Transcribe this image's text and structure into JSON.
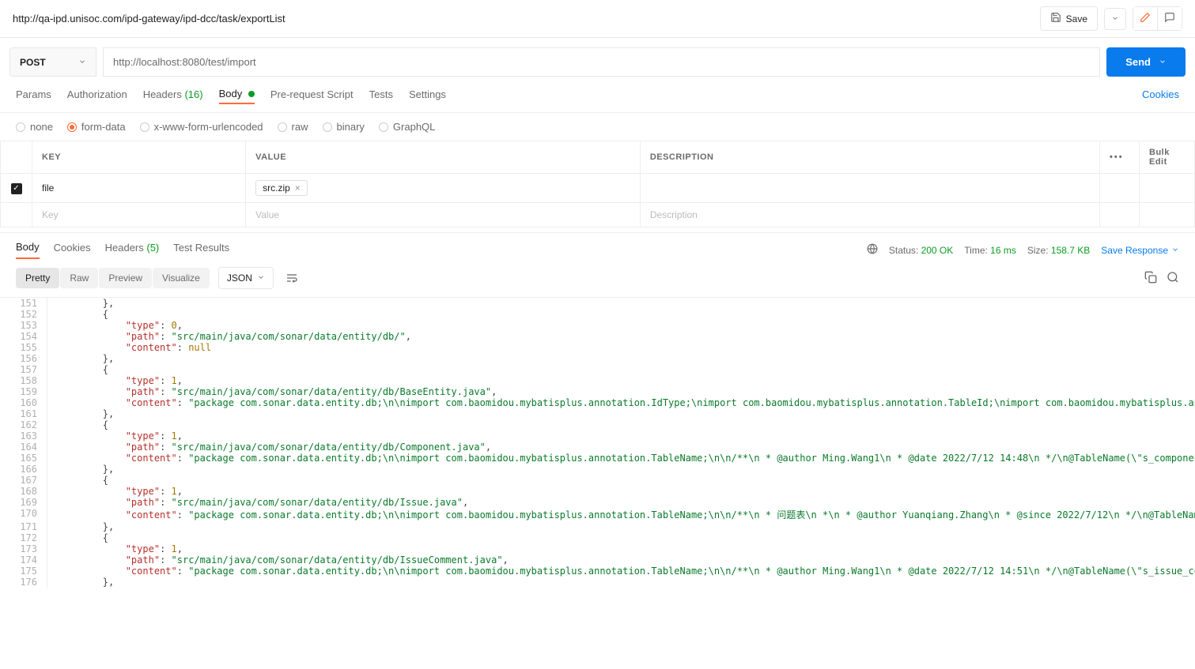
{
  "top_bar": {
    "url": "http://qa-ipd.unisoc.com/ipd-gateway/ipd-dcc/task/exportList",
    "save_label": "Save"
  },
  "request": {
    "method": "POST",
    "url": "http://localhost:8080/test/import",
    "send_label": "Send"
  },
  "tabs": {
    "params": "Params",
    "authorization": "Authorization",
    "headers": "Headers",
    "headers_count": "(16)",
    "body": "Body",
    "prerequest": "Pre-request Script",
    "tests": "Tests",
    "settings": "Settings",
    "cookies": "Cookies"
  },
  "body_types": {
    "none": "none",
    "form_data": "form-data",
    "x_www": "x-www-form-urlencoded",
    "raw": "raw",
    "binary": "binary",
    "graphql": "GraphQL"
  },
  "kv_table": {
    "key_header": "KEY",
    "value_header": "VALUE",
    "description_header": "DESCRIPTION",
    "bulk_edit": "Bulk Edit",
    "row_key": "file",
    "row_file": "src.zip",
    "key_placeholder": "Key",
    "value_placeholder": "Value",
    "description_placeholder": "Description"
  },
  "response_tabs": {
    "body": "Body",
    "cookies": "Cookies",
    "headers": "Headers",
    "headers_count": "(5)",
    "test_results": "Test Results"
  },
  "response_meta": {
    "status_label": "Status:",
    "status_value": "200 OK",
    "time_label": "Time:",
    "time_value": "16 ms",
    "size_label": "Size:",
    "size_value": "158.7 KB",
    "save_response": "Save Response"
  },
  "view": {
    "pretty": "Pretty",
    "raw": "Raw",
    "preview": "Preview",
    "visualize": "Visualize",
    "format": "JSON"
  },
  "code_lines": [
    {
      "n": 151,
      "indent": 2,
      "tokens": [
        {
          "t": "punc",
          "v": "},"
        }
      ]
    },
    {
      "n": 152,
      "indent": 2,
      "tokens": [
        {
          "t": "punc",
          "v": "{"
        }
      ]
    },
    {
      "n": 153,
      "indent": 3,
      "tokens": [
        {
          "t": "key",
          "v": "\"type\""
        },
        {
          "t": "punc",
          "v": ": "
        },
        {
          "t": "num",
          "v": "0"
        },
        {
          "t": "punc",
          "v": ","
        }
      ]
    },
    {
      "n": 154,
      "indent": 3,
      "tokens": [
        {
          "t": "key",
          "v": "\"path\""
        },
        {
          "t": "punc",
          "v": ": "
        },
        {
          "t": "str",
          "v": "\"src/main/java/com/sonar/data/entity/db/\""
        },
        {
          "t": "punc",
          "v": ","
        }
      ]
    },
    {
      "n": 155,
      "indent": 3,
      "tokens": [
        {
          "t": "key",
          "v": "\"content\""
        },
        {
          "t": "punc",
          "v": ": "
        },
        {
          "t": "null",
          "v": "null"
        }
      ]
    },
    {
      "n": 156,
      "indent": 2,
      "tokens": [
        {
          "t": "punc",
          "v": "},"
        }
      ]
    },
    {
      "n": 157,
      "indent": 2,
      "tokens": [
        {
          "t": "punc",
          "v": "{"
        }
      ]
    },
    {
      "n": 158,
      "indent": 3,
      "tokens": [
        {
          "t": "key",
          "v": "\"type\""
        },
        {
          "t": "punc",
          "v": ": "
        },
        {
          "t": "num",
          "v": "1"
        },
        {
          "t": "punc",
          "v": ","
        }
      ]
    },
    {
      "n": 159,
      "indent": 3,
      "tokens": [
        {
          "t": "key",
          "v": "\"path\""
        },
        {
          "t": "punc",
          "v": ": "
        },
        {
          "t": "str",
          "v": "\"src/main/java/com/sonar/data/entity/db/BaseEntity.java\""
        },
        {
          "t": "punc",
          "v": ","
        }
      ]
    },
    {
      "n": 160,
      "indent": 3,
      "tokens": [
        {
          "t": "key",
          "v": "\"content\""
        },
        {
          "t": "punc",
          "v": ": "
        },
        {
          "t": "str",
          "v": "\"package com.sonar.data.entity.db;\\n\\nimport com.baomidou.mybatisplus.annotation.IdType;\\nimport com.baomidou.mybatisplus.annotation.TableId;\\nimport com.baomidou.mybatisplus.annotation.TableLogic;"
        }
      ]
    },
    {
      "n": 161,
      "indent": 2,
      "tokens": [
        {
          "t": "punc",
          "v": "},"
        }
      ]
    },
    {
      "n": 162,
      "indent": 2,
      "tokens": [
        {
          "t": "punc",
          "v": "{"
        }
      ]
    },
    {
      "n": 163,
      "indent": 3,
      "tokens": [
        {
          "t": "key",
          "v": "\"type\""
        },
        {
          "t": "punc",
          "v": ": "
        },
        {
          "t": "num",
          "v": "1"
        },
        {
          "t": "punc",
          "v": ","
        }
      ]
    },
    {
      "n": 164,
      "indent": 3,
      "tokens": [
        {
          "t": "key",
          "v": "\"path\""
        },
        {
          "t": "punc",
          "v": ": "
        },
        {
          "t": "str",
          "v": "\"src/main/java/com/sonar/data/entity/db/Component.java\""
        },
        {
          "t": "punc",
          "v": ","
        }
      ]
    },
    {
      "n": 165,
      "indent": 3,
      "tokens": [
        {
          "t": "key",
          "v": "\"content\""
        },
        {
          "t": "punc",
          "v": ": "
        },
        {
          "t": "str",
          "v": "\"package com.sonar.data.entity.db;\\n\\nimport com.baomidou.mybatisplus.annotation.TableName;\\n\\n/**\\n * @author Ming.Wang1\\n * @date 2022/7/12 14:48\\n */\\n@TableName(\\\"s_component\\\")\\npublic class C"
        }
      ]
    },
    {
      "n": 166,
      "indent": 2,
      "tokens": [
        {
          "t": "punc",
          "v": "},"
        }
      ]
    },
    {
      "n": 167,
      "indent": 2,
      "tokens": [
        {
          "t": "punc",
          "v": "{"
        }
      ]
    },
    {
      "n": 168,
      "indent": 3,
      "tokens": [
        {
          "t": "key",
          "v": "\"type\""
        },
        {
          "t": "punc",
          "v": ": "
        },
        {
          "t": "num",
          "v": "1"
        },
        {
          "t": "punc",
          "v": ","
        }
      ]
    },
    {
      "n": 169,
      "indent": 3,
      "tokens": [
        {
          "t": "key",
          "v": "\"path\""
        },
        {
          "t": "punc",
          "v": ": "
        },
        {
          "t": "str",
          "v": "\"src/main/java/com/sonar/data/entity/db/Issue.java\""
        },
        {
          "t": "punc",
          "v": ","
        }
      ]
    },
    {
      "n": 170,
      "indent": 3,
      "tokens": [
        {
          "t": "key",
          "v": "\"content\""
        },
        {
          "t": "punc",
          "v": ": "
        },
        {
          "t": "str",
          "v": "\"package com.sonar.data.entity.db;\\n\\nimport com.baomidou.mybatisplus.annotation.TableName;\\n\\n/**\\n * 问题表\\n *\\n * @author Yuanqiang.Zhang\\n * @since 2022/7/12\\n */\\n@TableName(\\\"s_issue\\\")\\npub"
        }
      ]
    },
    {
      "n": 171,
      "indent": 2,
      "tokens": [
        {
          "t": "punc",
          "v": "},"
        }
      ]
    },
    {
      "n": 172,
      "indent": 2,
      "tokens": [
        {
          "t": "punc",
          "v": "{"
        }
      ]
    },
    {
      "n": 173,
      "indent": 3,
      "tokens": [
        {
          "t": "key",
          "v": "\"type\""
        },
        {
          "t": "punc",
          "v": ": "
        },
        {
          "t": "num",
          "v": "1"
        },
        {
          "t": "punc",
          "v": ","
        }
      ]
    },
    {
      "n": 174,
      "indent": 3,
      "tokens": [
        {
          "t": "key",
          "v": "\"path\""
        },
        {
          "t": "punc",
          "v": ": "
        },
        {
          "t": "str",
          "v": "\"src/main/java/com/sonar/data/entity/db/IssueComment.java\""
        },
        {
          "t": "punc",
          "v": ","
        }
      ]
    },
    {
      "n": 175,
      "indent": 3,
      "tokens": [
        {
          "t": "key",
          "v": "\"content\""
        },
        {
          "t": "punc",
          "v": ": "
        },
        {
          "t": "str",
          "v": "\"package com.sonar.data.entity.db;\\n\\nimport com.baomidou.mybatisplus.annotation.TableName;\\n\\n/**\\n * @author Ming.Wang1\\n * @date 2022/7/12 14:51\\n */\\n@TableName(\\\"s_issue_comment\\\")\\npublic cla"
        }
      ]
    },
    {
      "n": 176,
      "indent": 2,
      "tokens": [
        {
          "t": "punc",
          "v": "},"
        }
      ]
    }
  ]
}
